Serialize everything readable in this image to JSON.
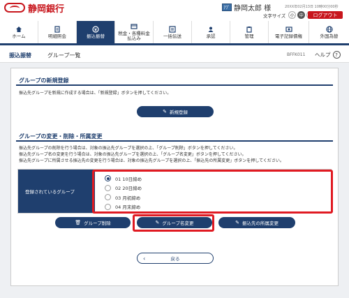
{
  "header": {
    "bank_name": "静岡銀行",
    "user_badge": "ｱﾌﾟ",
    "user_name": "静岡太郎 様",
    "last_login": "20XX年02月13日 10時00分00秒",
    "font_size_label": "文字サイズ",
    "font_sizes": [
      "小",
      "中",
      "大"
    ],
    "logout_label": "ログアウト"
  },
  "nav": {
    "items": [
      {
        "label": "ホーム",
        "icon": "home-icon"
      },
      {
        "label": "明細照会",
        "icon": "document-icon"
      },
      {
        "label": "振込振替",
        "icon": "transfer-icon"
      },
      {
        "label": "税金・各種料金\n払込み",
        "icon": "tax-icon"
      },
      {
        "label": "一括伝送",
        "icon": "bulk-transfer-icon"
      },
      {
        "label": "承認",
        "icon": "approval-icon"
      },
      {
        "label": "管理",
        "icon": "management-icon"
      },
      {
        "label": "電子記録債権",
        "icon": "e-bond-icon"
      },
      {
        "label": "外国為替",
        "icon": "globe-icon"
      }
    ]
  },
  "title": {
    "category": "振込振替",
    "page": "グループ一覧",
    "screen_id": "BFFK011",
    "help_label": "ヘルプ",
    "help_icon": "?"
  },
  "new_section": {
    "title": "グループの新規登録",
    "desc": "振込先グループを新規に作成する場合は、「新規登録」ボタンを押してください。",
    "button": "新規登録"
  },
  "edit_section": {
    "title": "グループの変更・削除・所属変更",
    "desc1": "振込先グループの削除を行う場合は、対象の振込先グループを選択の上、「グループ削除」ボタンを押してください。",
    "desc2": "振込先グループ名の変更を行う場合は、対象の振込先グループを選択の上、「グループ名変更」ボタンを押してください。",
    "desc3": "振込先グループに所属させる振込先の変更を行う場合は、対象の振込先グループを選択の上、「振込先の所属変更」ボタンを押してください。",
    "form_label": "登録されているグループ",
    "groups": [
      "01 10日締め",
      "02 20日締め",
      "03 月初締め",
      "04 月末締め"
    ],
    "selected_index": 0,
    "delete_button": "グループ削除",
    "rename_button": "グループ名変更",
    "membership_button": "振込先の所属変更"
  },
  "back_button": "戻る",
  "colors": {
    "brand": "#c8161d",
    "navy": "#1f3f6e",
    "highlight": "#e01a22"
  }
}
